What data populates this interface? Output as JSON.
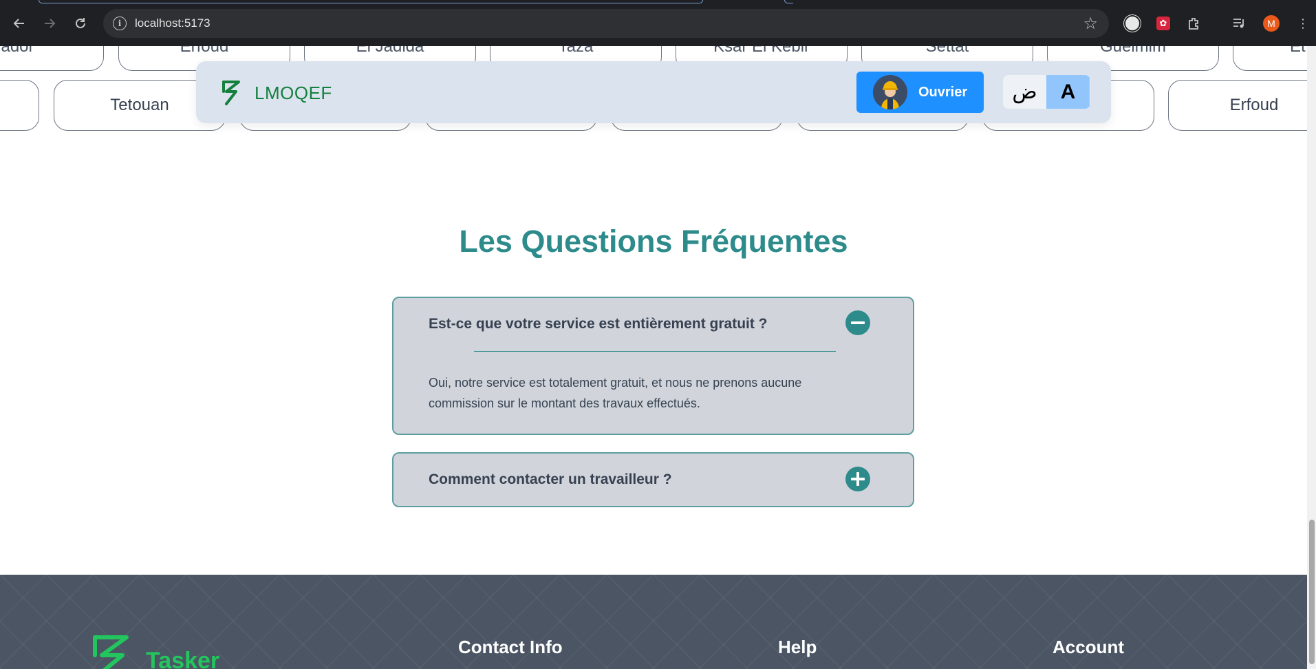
{
  "browser": {
    "url": "localhost:5173",
    "profile_initial": "M",
    "icons": [
      "back-icon",
      "forward-icon",
      "reload-icon",
      "site-info-icon",
      "bookmark-star-icon",
      "extensions-icon",
      "media-icon"
    ]
  },
  "cities": {
    "top_row": [
      "ador",
      "Erfoud",
      "El Jadida",
      "Taza",
      "Ksar El Kebir",
      "Settat",
      "Guelmim",
      "Et"
    ],
    "bottom_row": [
      "",
      "Tetouan",
      "",
      "",
      "",
      "",
      "",
      "",
      "Erfoud"
    ]
  },
  "navbar": {
    "brand": "LMOQEF",
    "role_button": "Ouvrier",
    "lang_options": [
      "ض",
      "A"
    ],
    "active_lang": "A"
  },
  "faq": {
    "title": "Les Questions Fréquentes",
    "items": [
      {
        "question": "Est-ce que votre service est entièrement gratuit ?",
        "answer": "Oui, notre service est totalement gratuit, et nous ne prenons aucune commission sur le montant des travaux effectués.",
        "expanded": true
      },
      {
        "question": "Comment contacter un travailleur ?",
        "answer": "",
        "expanded": false
      }
    ]
  },
  "footer": {
    "brand": "Tasker",
    "columns": [
      "Contact Info",
      "Help",
      "Account"
    ]
  },
  "colors": {
    "accent_teal": "#2e8b8b",
    "brand_green": "#15803d",
    "primary_blue": "#1e90ff",
    "footer_bg": "#4b5563"
  }
}
